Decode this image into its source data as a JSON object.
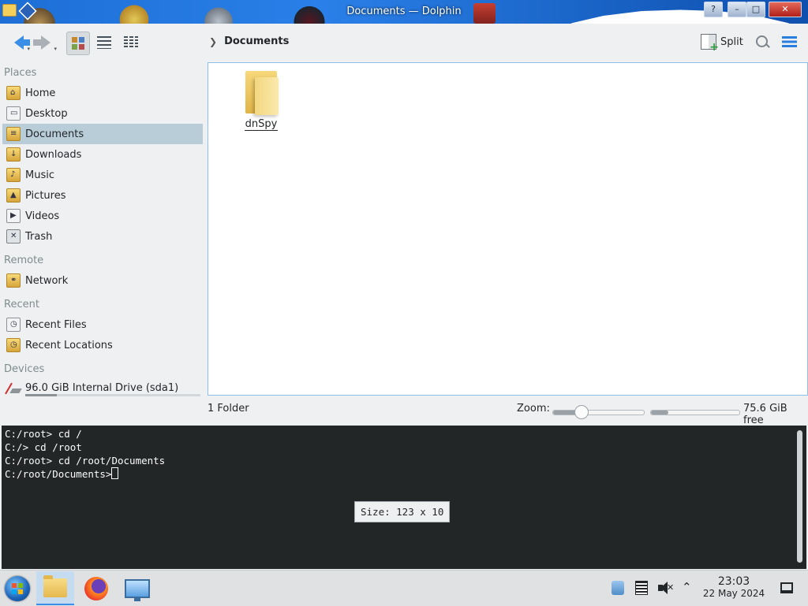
{
  "window": {
    "title": "Documents — Dolphin"
  },
  "toolbar": {
    "breadcrumb": [
      "Documents"
    ],
    "split_label": "Split"
  },
  "sidebar": {
    "sections": [
      {
        "heading": "Places",
        "items": [
          {
            "label": "Home",
            "icon": "home-folder-icon"
          },
          {
            "label": "Desktop",
            "icon": "desktop-folder-icon"
          },
          {
            "label": "Documents",
            "icon": "documents-folder-icon",
            "selected": true
          },
          {
            "label": "Downloads",
            "icon": "downloads-folder-icon"
          },
          {
            "label": "Music",
            "icon": "music-folder-icon"
          },
          {
            "label": "Pictures",
            "icon": "pictures-folder-icon"
          },
          {
            "label": "Videos",
            "icon": "videos-folder-icon"
          },
          {
            "label": "Trash",
            "icon": "trash-icon"
          }
        ]
      },
      {
        "heading": "Remote",
        "items": [
          {
            "label": "Network",
            "icon": "network-folder-icon"
          }
        ]
      },
      {
        "heading": "Recent",
        "items": [
          {
            "label": "Recent Files",
            "icon": "recent-files-icon"
          },
          {
            "label": "Recent Locations",
            "icon": "recent-locations-icon"
          }
        ]
      },
      {
        "heading": "Devices",
        "items": [
          {
            "label": "96.0 GiB Internal Drive (sda1)",
            "icon": "drive-icon",
            "usage_fraction": 0.18
          }
        ]
      }
    ]
  },
  "files": [
    {
      "name": "dnSpy",
      "type": "folder"
    }
  ],
  "status": {
    "summary": "1 Folder",
    "zoom_label": "Zoom:",
    "zoom_level": 0.3,
    "free_space": "75.6 GiB free",
    "used_fraction": 0.2
  },
  "terminal": {
    "lines": [
      "C:/root> cd /",
      "C:/> cd /root",
      "C:/root> cd /root/Documents"
    ],
    "prompt": "C:/root/Documents>",
    "size_tooltip": "Size: 123 x 10"
  },
  "taskbar": {
    "time": "23:03",
    "date": "22 May 2024"
  },
  "colors": {
    "accent": "#3b8ee6",
    "selection": "#b9cdd9",
    "terminal_bg": "#232627"
  }
}
